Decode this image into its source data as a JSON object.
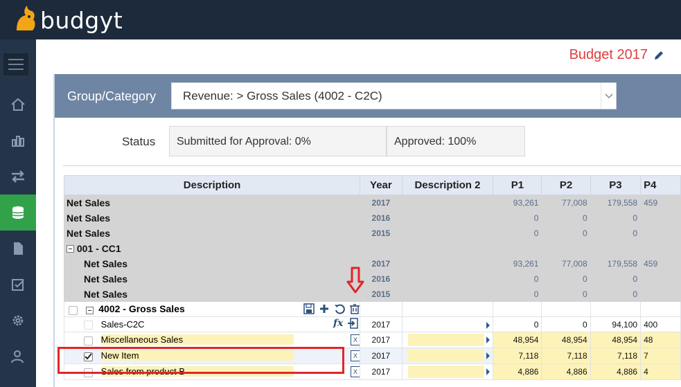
{
  "app": {
    "name": "budgyt"
  },
  "header": {
    "title": "Budget 2017"
  },
  "group": {
    "label": "Group/Category",
    "value": "Revenue: > Gross Sales (4002 - C2C)"
  },
  "status": {
    "label": "Status",
    "submitted": "Submitted for Approval: 0%",
    "approved": "Approved: 100%"
  },
  "table": {
    "columns": {
      "description": "Description",
      "year": "Year",
      "description2": "Description 2",
      "p1": "P1",
      "p2": "P2",
      "p3": "P3",
      "p4": "P4"
    },
    "rows": [
      {
        "desc": "Net Sales",
        "year": "2017",
        "p1": "93,261",
        "p2": "77,008",
        "p3": "179,558",
        "p4": "459"
      },
      {
        "desc": "Net Sales",
        "year": "2016",
        "p1": "0",
        "p2": "0",
        "p3": "0",
        "p4": ""
      },
      {
        "desc": "Net Sales",
        "year": "2015",
        "p1": "0",
        "p2": "0",
        "p3": "0",
        "p4": ""
      },
      {
        "desc": "001 - CC1"
      },
      {
        "desc": "Net Sales",
        "year": "2017",
        "p1": "93,261",
        "p2": "77,008",
        "p3": "179,558",
        "p4": "459"
      },
      {
        "desc": "Net Sales",
        "year": "2016",
        "p1": "0",
        "p2": "0",
        "p3": "0",
        "p4": ""
      },
      {
        "desc": "Net Sales",
        "year": "2015",
        "p1": "0",
        "p2": "0",
        "p3": "0",
        "p4": ""
      },
      {
        "desc": "4002 - Gross Sales"
      },
      {
        "desc": "Sales-C2C",
        "year": "2017",
        "p1": "0",
        "p2": "0",
        "p3": "94,100",
        "p4": "400"
      },
      {
        "desc": "Miscellaneous Sales",
        "year": "2017",
        "p1": "48,954",
        "p2": "48,954",
        "p3": "48,954",
        "p4": "48"
      },
      {
        "desc": "New Item",
        "year": "2017",
        "p1": "7,118",
        "p2": "7,118",
        "p3": "7,118",
        "p4": "7"
      },
      {
        "desc": "Sales from product B",
        "year": "2017",
        "p1": "4,886",
        "p2": "4,886",
        "p3": "4,886",
        "p4": "4"
      }
    ]
  },
  "colors": {
    "topbar": "#1d2a3c",
    "sidebar": "#253549",
    "active": "#32a24a",
    "accent_red": "#e03c3c",
    "highlight": "#fdf3b8"
  },
  "icons": [
    "menu-icon",
    "home-icon",
    "bar-chart-icon",
    "transfer-icon",
    "database-icon",
    "document-icon",
    "checklist-icon",
    "gear-icon",
    "users-icon",
    "pencil-icon",
    "save-icon",
    "plus-icon",
    "undo-icon",
    "trash-icon",
    "fx-icon",
    "import-icon",
    "excel-icon"
  ]
}
